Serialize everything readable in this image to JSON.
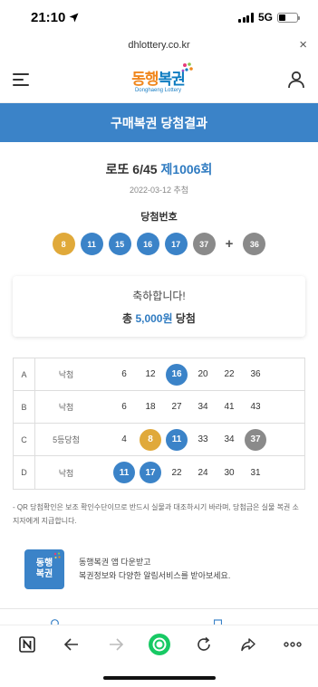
{
  "status_bar": {
    "time": "21:10",
    "network": "5G"
  },
  "browser": {
    "url": "dhlottery.co.kr"
  },
  "site": {
    "logo_text_a": "동행",
    "logo_text_b": "복권",
    "logo_sub": "Donghaeng Lottery"
  },
  "page": {
    "title": "구매복권 당첨결과"
  },
  "draw": {
    "game": "로또 6/45",
    "round": "제1006회",
    "date": "2022-03-12 추첨",
    "win_label": "당첨번호",
    "numbers": [
      "8",
      "11",
      "15",
      "16",
      "17",
      "37"
    ],
    "number_colors": [
      "#e0a93a",
      "#3b83c8",
      "#3b83c8",
      "#3b83c8",
      "#3b83c8",
      "#8a8a8a"
    ],
    "plus": "+",
    "bonus": "36",
    "bonus_color": "#8a8a8a"
  },
  "congrats": {
    "message": "축하합니다!",
    "total_prefix": "총",
    "amount": "5,000원",
    "total_suffix": "당첨"
  },
  "results": [
    {
      "letter": "A",
      "status": "낙첨",
      "numbers": [
        "6",
        "12",
        "16",
        "20",
        "22",
        "36"
      ],
      "hits": [
        false,
        false,
        true,
        false,
        false,
        false
      ],
      "hit_colors": [
        "",
        "",
        "#3b83c8",
        "",
        "",
        ""
      ]
    },
    {
      "letter": "B",
      "status": "낙첨",
      "numbers": [
        "6",
        "18",
        "27",
        "34",
        "41",
        "43"
      ],
      "hits": [
        false,
        false,
        false,
        false,
        false,
        false
      ],
      "hit_colors": [
        "",
        "",
        "",
        "",
        "",
        ""
      ]
    },
    {
      "letter": "C",
      "status": "5등당첨",
      "numbers": [
        "4",
        "8",
        "11",
        "33",
        "34",
        "37"
      ],
      "hits": [
        false,
        true,
        true,
        false,
        false,
        true
      ],
      "hit_colors": [
        "",
        "#e0a93a",
        "#3b83c8",
        "",
        "",
        "#8a8a8a"
      ]
    },
    {
      "letter": "D",
      "status": "낙첨",
      "numbers": [
        "11",
        "17",
        "22",
        "24",
        "30",
        "31"
      ],
      "hits": [
        true,
        true,
        false,
        false,
        false,
        false
      ],
      "hit_colors": [
        "#3b83c8",
        "#3b83c8",
        "",
        "",
        "",
        ""
      ]
    }
  ],
  "notice": "- QR 당첨확인은 보조 확인수단이므로 반드시 실물과 대조하시기 바라며, 당첨금은 실물 복권 소지자에게 지급합니다.",
  "promo": {
    "logo_line1": "동행",
    "logo_line2": "복권",
    "line1": "동행복권 앱 다운받고",
    "line2": "복권정보와 다양한 알림서비스를 받아보세요."
  },
  "toolbar_icons": [
    "naver-n-icon",
    "back-arrow-icon",
    "forward-arrow-icon",
    "home-green-icon",
    "reload-icon",
    "share-icon",
    "more-icon"
  ]
}
